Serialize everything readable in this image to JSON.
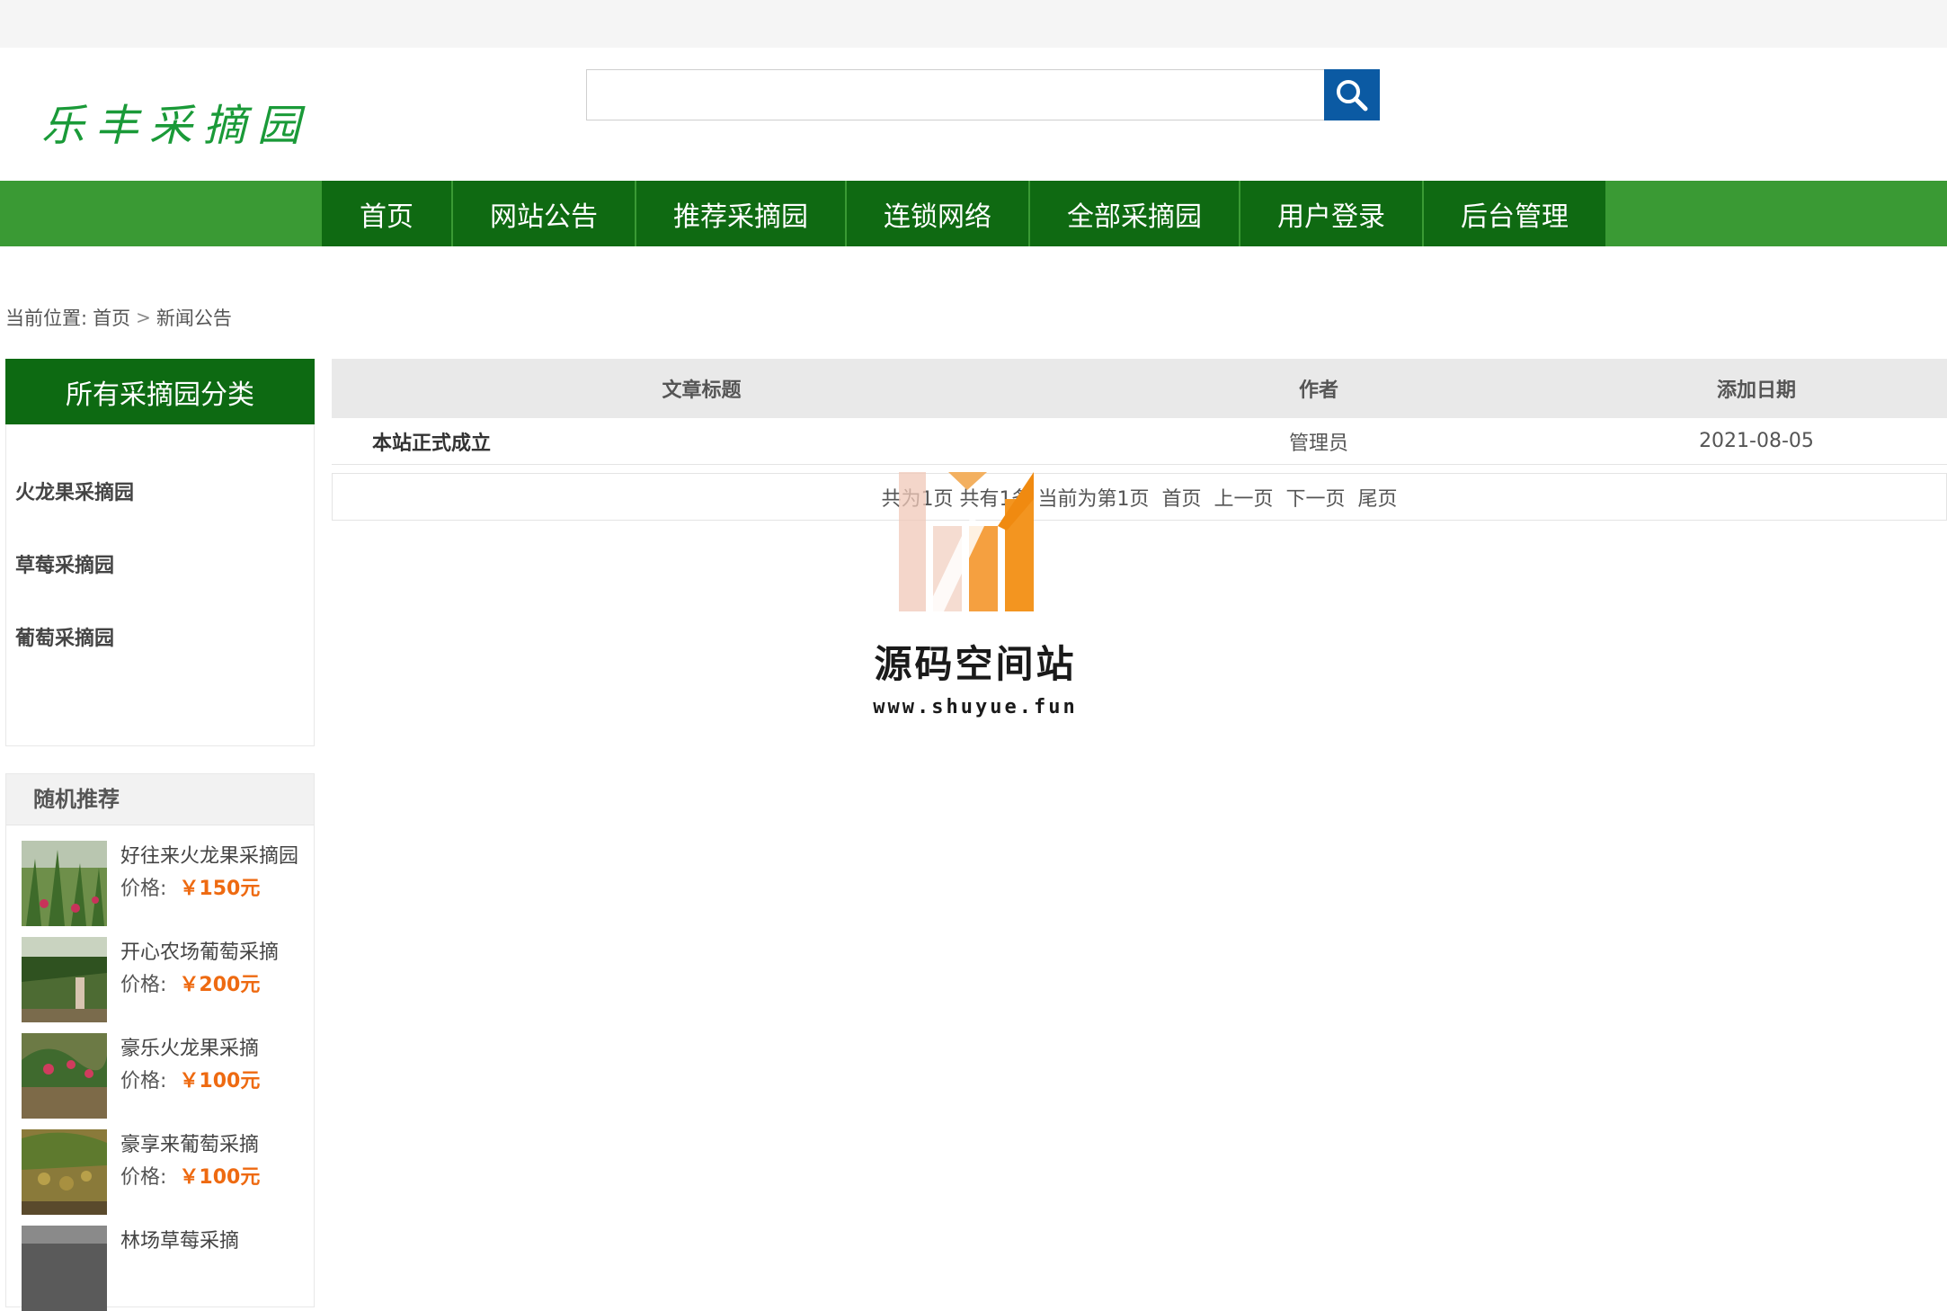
{
  "header": {
    "logo_text": "乐丰采摘园",
    "search": {
      "placeholder": "",
      "value": ""
    }
  },
  "nav": {
    "items": [
      "首页",
      "网站公告",
      "推荐采摘园",
      "连锁网络",
      "全部采摘园",
      "用户登录",
      "后台管理"
    ]
  },
  "breadcrumb": {
    "prefix": "当前位置:",
    "home": "首页",
    "separator": ">",
    "current": "新闻公告"
  },
  "sidebar": {
    "category_title": "所有采摘园分类",
    "categories": [
      "火龙果采摘园",
      "草莓采摘园",
      "葡萄采摘园"
    ],
    "recommend_title": "随机推荐",
    "price_label": "价格:",
    "recommendations": [
      {
        "name": "好往来火龙果采摘园",
        "price": "￥150元"
      },
      {
        "name": "开心农场葡萄采摘",
        "price": "￥200元"
      },
      {
        "name": "豪乐火龙果采摘",
        "price": "￥100元"
      },
      {
        "name": "豪享来葡萄采摘",
        "price": "￥100元"
      },
      {
        "name": "林场草莓采摘",
        "price": ""
      }
    ]
  },
  "articles": {
    "columns": [
      "文章标题",
      "作者",
      "添加日期"
    ],
    "rows": [
      {
        "title": "本站正式成立",
        "author": "管理员",
        "date": "2021-08-05"
      }
    ],
    "pager": {
      "summary": "共为1页 共有1条 当前为第1页",
      "first": "首页",
      "prev": "上一页",
      "next": "下一页",
      "last": "尾页"
    }
  },
  "watermark": {
    "title": "源码空间站",
    "url": "www.shuyue.fun"
  },
  "colors": {
    "nav_dark": "#0f6a12",
    "nav_bar": "#3a9a34",
    "search_button": "#0b5aa3",
    "price": "#ee6a11",
    "logo": "#1a9a38"
  }
}
